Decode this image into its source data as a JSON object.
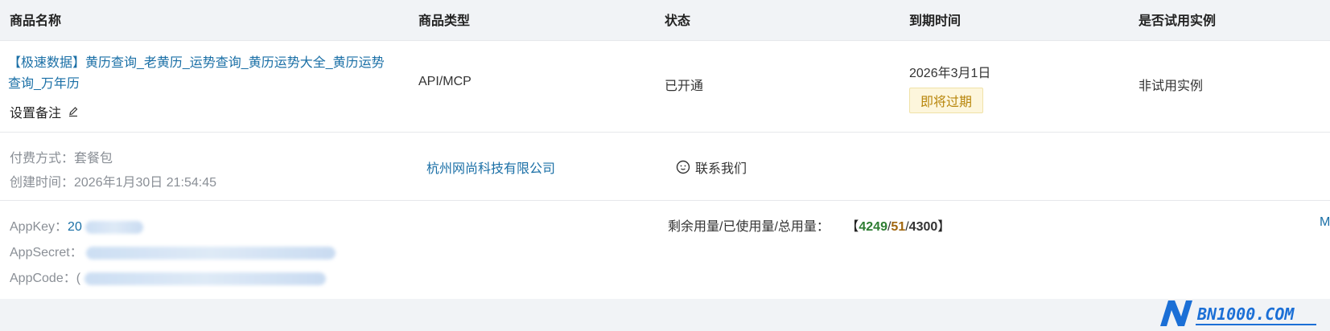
{
  "columns": {
    "name": "商品名称",
    "type": "商品类型",
    "status": "状态",
    "expiry": "到期时间",
    "trial": "是否试用实例"
  },
  "product": {
    "title": "【极速数据】黄历查询_老黄历_运势查询_黄历运势大全_黄历运势查询_万年历",
    "note_label": "设置备注",
    "type": "API/MCP",
    "status": "已开通",
    "expiry_date": "2026年3月1日",
    "expiry_badge": "即将过期",
    "trial": "非试用实例"
  },
  "details": {
    "payment": "付费方式：套餐包",
    "created": "创建时间：2026年1月30日 21:54:45",
    "vendor": "杭州网尚科技有限公司",
    "contact": "联系我们"
  },
  "credentials": {
    "appkey_label": "AppKey：",
    "appkey_prefix": "20",
    "appsecret_label": "AppSecret：",
    "appcode_label": "AppCode：",
    "appcode_prefix": "("
  },
  "usage": {
    "label": "剩余用量/已使用量/总用量：",
    "open": "【",
    "remaining": "4249",
    "slash": "/",
    "used": "51",
    "total": "4300",
    "close": "】",
    "edge_text": "M"
  },
  "colors": {
    "link": "#1a6fa6",
    "remaining": "#2e7d32",
    "used": "#a0660e",
    "badge_bg": "#fdf6dc",
    "badge_text": "#b8860b"
  }
}
